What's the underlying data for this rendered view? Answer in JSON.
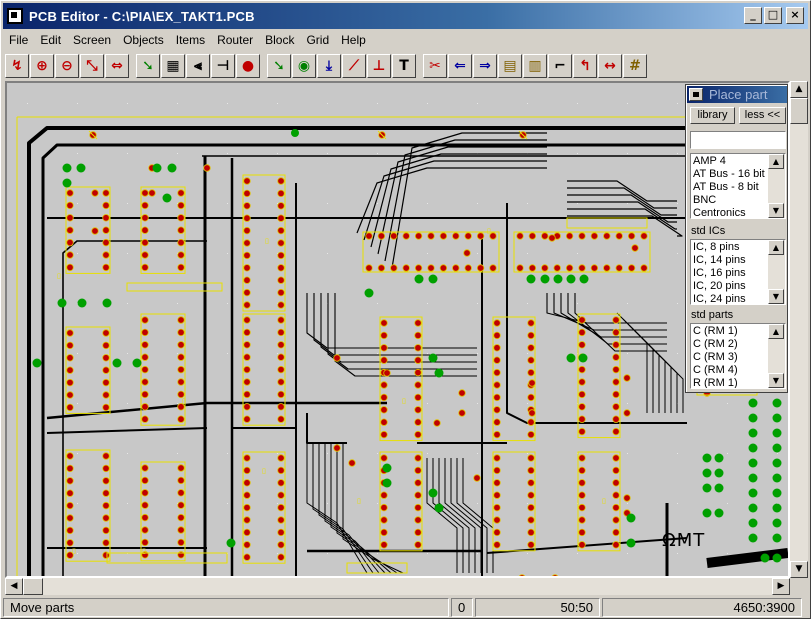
{
  "window": {
    "title": "PCB Editor - C:\\PIA\\EX_TAKT1.PCB",
    "minimize": "_",
    "maximize": "□",
    "close": "×"
  },
  "menu": [
    "File",
    "Edit",
    "Screen",
    "Objects",
    "Items",
    "Router",
    "Block",
    "Grid",
    "Help"
  ],
  "toolbar": {
    "tools": [
      {
        "name": "select-tool-icon",
        "glyph": "↯",
        "color": "#c00000"
      },
      {
        "name": "zoom-in-icon",
        "glyph": "⊕",
        "color": "#c00000"
      },
      {
        "name": "zoom-out-icon",
        "glyph": "⊖",
        "color": "#c00000"
      },
      {
        "name": "zoom-window-icon",
        "glyph": "⤡",
        "color": "#c00000"
      },
      {
        "name": "redraw-icon",
        "glyph": "⇔",
        "color": "#c00000"
      },
      {
        "name": "move-part-icon",
        "glyph": "➘",
        "color": "#008000"
      },
      {
        "name": "place-ic-icon",
        "glyph": "▦",
        "color": "#000000"
      },
      {
        "name": "place-resistor-icon",
        "glyph": "⫷",
        "color": "#000000"
      },
      {
        "name": "place-capacitor-icon",
        "glyph": "⊣",
        "color": "#000000"
      },
      {
        "name": "place-pad-icon",
        "glyph": "●",
        "color": "#c00000"
      },
      {
        "name": "route-icon",
        "glyph": "➘",
        "color": "#008000"
      },
      {
        "name": "via-icon",
        "glyph": "◉",
        "color": "#008000"
      },
      {
        "name": "pin-icon",
        "glyph": "⤓",
        "color": "#0000a0"
      },
      {
        "name": "wire-icon",
        "glyph": "⟋",
        "color": "#c00000"
      },
      {
        "name": "trace-icon",
        "glyph": "⊥",
        "color": "#c00000"
      },
      {
        "name": "text-icon",
        "glyph": "T",
        "color": "#000000"
      },
      {
        "name": "delete-icon",
        "glyph": "✂",
        "color": "#c00000"
      },
      {
        "name": "move-wire-icon",
        "glyph": "⇐",
        "color": "#0000a0"
      },
      {
        "name": "redo-icon",
        "glyph": "⇒",
        "color": "#0000a0"
      },
      {
        "name": "block-icon",
        "glyph": "▤",
        "color": "#806000"
      },
      {
        "name": "block-copy-icon",
        "glyph": "▥",
        "color": "#806000"
      },
      {
        "name": "connect-icon",
        "glyph": "⌐",
        "color": "#000000"
      },
      {
        "name": "bend-icon",
        "glyph": "↰",
        "color": "#c00000"
      },
      {
        "name": "stretch-icon",
        "glyph": "↔",
        "color": "#c00000"
      },
      {
        "name": "grid-icon",
        "glyph": "#",
        "color": "#806000"
      }
    ]
  },
  "panel": {
    "title": "Place part",
    "library_button": "library",
    "less_button": "less <<",
    "search_value": "",
    "list1": [
      "AMP 4",
      "AT Bus - 16 bit",
      "AT Bus - 8 bit",
      "BNC",
      "Centronics"
    ],
    "label2": "std ICs",
    "list2": [
      "IC,  8 pins",
      "IC, 14 pins",
      "IC, 16 pins",
      "IC, 20 pins",
      "IC, 24 pins"
    ],
    "label3": "std parts",
    "list3": [
      "C (RM 1)",
      "C (RM 2)",
      "C (RM 3)",
      "C (RM 4)",
      "R (RM 1)"
    ]
  },
  "status": {
    "message": "Move parts",
    "count": "0",
    "grid": "50:50",
    "coords": "4650:3900"
  },
  "board": {
    "label": "ΩMT"
  },
  "colors": {
    "background": "#c8c8c8",
    "pad": "#c00000",
    "pad_ring": "#e0c000",
    "trace": "#000000",
    "silkscreen": "#e8e000",
    "via": "#00a000"
  }
}
